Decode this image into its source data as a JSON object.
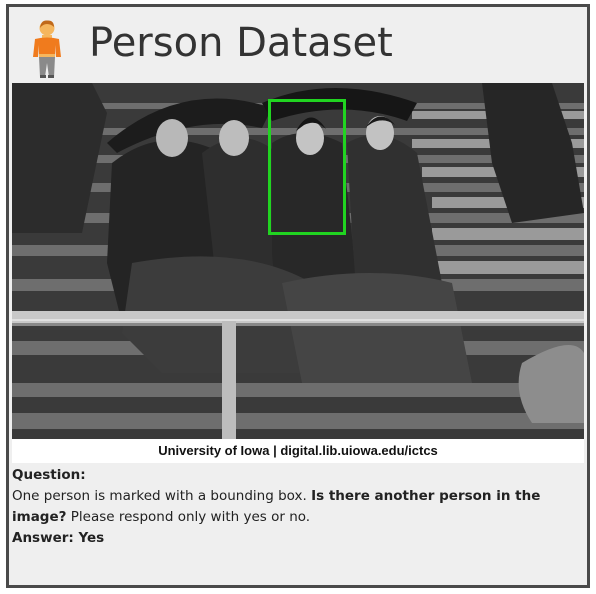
{
  "header": {
    "title": "Person Dataset",
    "icon": "person-standing-icon"
  },
  "photo": {
    "credit": "University of Iowa | digital.lib.uiowa.edu/ictcs",
    "bounding_box_color": "#21d421"
  },
  "qa": {
    "question_label": "Question:",
    "question_part1": "One person is marked with a bounding box. ",
    "question_bold": "Is there another person in the image?",
    "question_part2": " Please respond only with yes or no.",
    "answer_label": "Answer: ",
    "answer_value": "Yes"
  },
  "colors": {
    "card_border": "#4a4a4a",
    "card_background": "#efefef",
    "title_text": "#333333"
  }
}
